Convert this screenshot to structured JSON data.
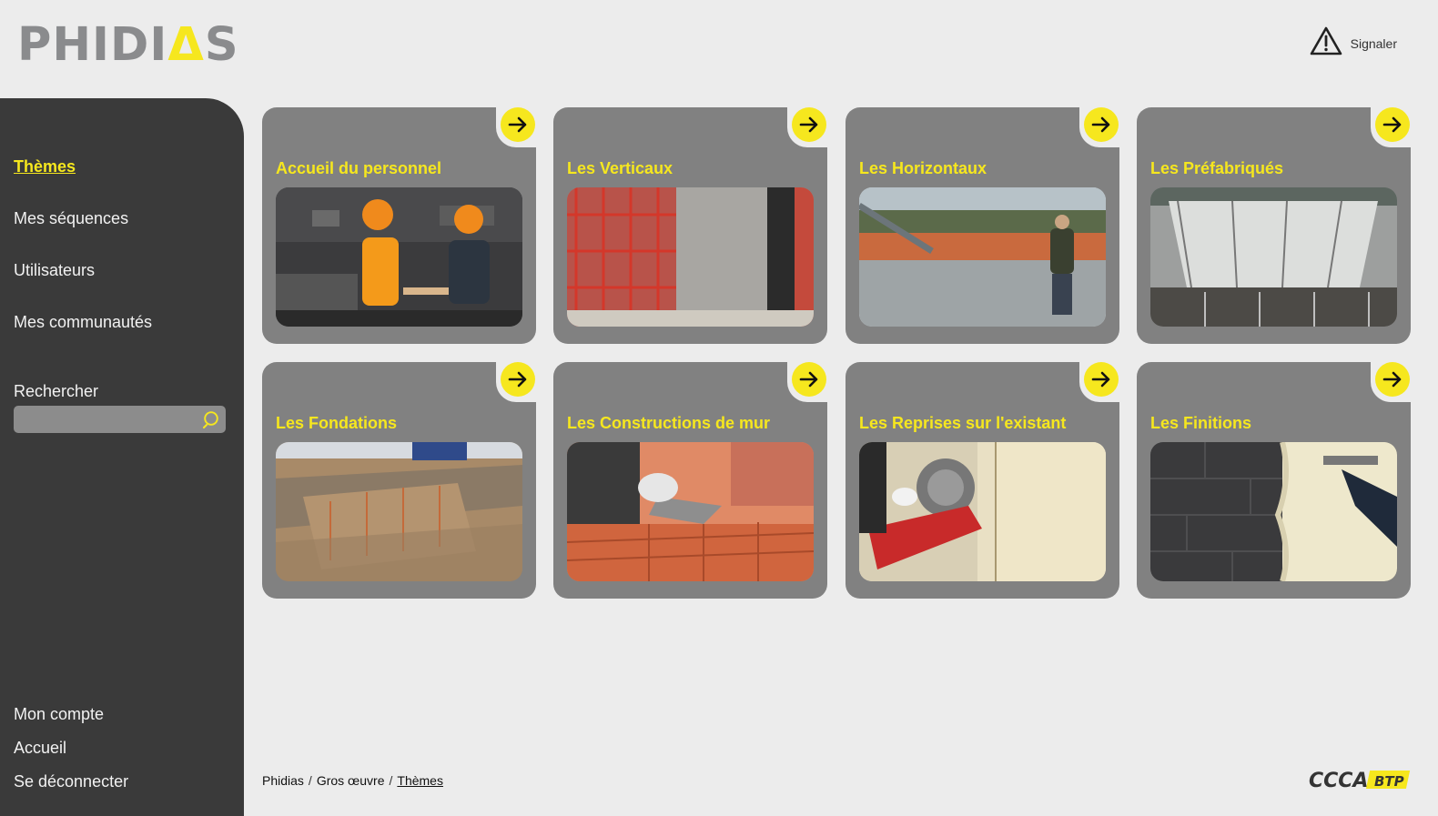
{
  "logo": {
    "part1": "PHIDI",
    "part2": "Δ",
    "part3": "S"
  },
  "header": {
    "report_label": "Signaler"
  },
  "sidebar": {
    "nav": [
      {
        "label": "Thèmes",
        "active": true
      },
      {
        "label": "Mes séquences"
      },
      {
        "label": "Utilisateurs"
      },
      {
        "label": "Mes communautés"
      }
    ],
    "search": {
      "label": "Rechercher",
      "value": "",
      "placeholder": ""
    },
    "footer_nav": [
      {
        "label": "Mon compte"
      },
      {
        "label": "Accueil"
      },
      {
        "label": "Se déconnecter"
      }
    ]
  },
  "themes": [
    {
      "title": "Accueil du personnel",
      "image": "two workers in hard hats shaking hands"
    },
    {
      "title": "Les Verticaux",
      "image": "concrete wall with red scaffolding"
    },
    {
      "title": "Les Horizontaux",
      "image": "workers pouring concrete slab"
    },
    {
      "title": "Les Préfabriqués",
      "image": "prefabricated floor slab with railings"
    },
    {
      "title": "Les Fondations",
      "image": "foundation trenches with rebar"
    },
    {
      "title": "Les Constructions de mur",
      "image": "laying clay bricks with trowel"
    },
    {
      "title": "Les Reprises sur l'existant",
      "image": "cutting saw on existing wall"
    },
    {
      "title": "Les Finitions",
      "image": "spray plaster on block wall"
    }
  ],
  "breadcrumb": [
    "Phidias",
    "Gros œuvre",
    "Thèmes"
  ],
  "brand": {
    "footer_logo": "CCCA",
    "footer_logo_suffix": "BTP"
  },
  "colors": {
    "accent": "#f6e71e",
    "sidebar": "#3a3a3a",
    "card": "#818181",
    "background": "#ececec"
  },
  "icons": {
    "report": "warning-triangle-icon",
    "search": "search-icon",
    "card_action": "arrow-right-icon"
  }
}
